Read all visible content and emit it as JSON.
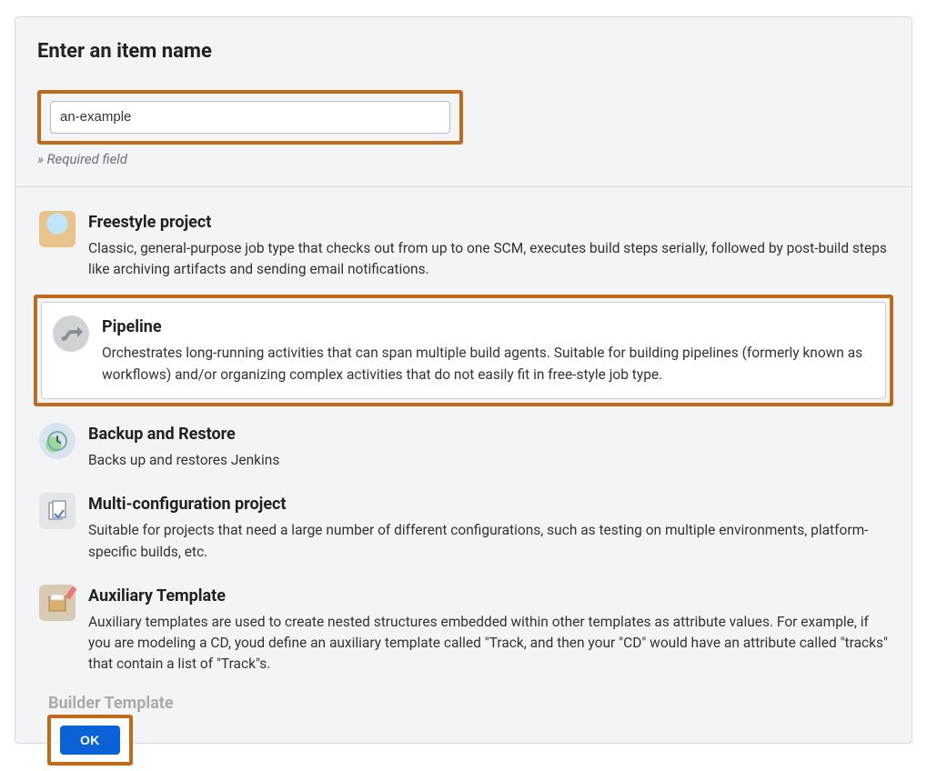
{
  "header": {
    "title": "Enter an item name",
    "input_value": "an-example",
    "input_placeholder": "",
    "required_note": "» Required field"
  },
  "types": [
    {
      "id": "freestyle",
      "title": "Freestyle project",
      "desc": "Classic, general-purpose job type that checks out from up to one SCM, executes build steps serially, followed by post-build steps like archiving artifacts and sending email notifications.",
      "selected": false,
      "highlighted": false
    },
    {
      "id": "pipeline",
      "title": "Pipeline",
      "desc": "Orchestrates long-running activities that can span multiple build agents. Suitable for building pipelines (formerly known as workflows) and/or organizing complex activities that do not easily fit in free-style job type.",
      "selected": true,
      "highlighted": true
    },
    {
      "id": "backup",
      "title": "Backup and Restore",
      "desc": "Backs up and restores Jenkins",
      "selected": false,
      "highlighted": false
    },
    {
      "id": "multi",
      "title": "Multi-configuration project",
      "desc": "Suitable for projects that need a large number of different configurations, such as testing on multiple environments, platform-specific builds, etc.",
      "selected": false,
      "highlighted": false
    },
    {
      "id": "aux",
      "title": "Auxiliary Template",
      "desc": "Auxiliary templates are used to create nested structures embedded within other templates as attribute values. For example, if you are modeling a CD, youd define an auxiliary template called \"Track, and then your \"CD\" would have an attribute called \"tracks\" that contain a list of \"Track\"s.",
      "selected": false,
      "highlighted": false
    },
    {
      "id": "builder",
      "title": "Builder Template",
      "desc": "",
      "selected": false,
      "highlighted": false
    }
  ],
  "footer": {
    "ok_label": "OK"
  },
  "colors": {
    "highlight": "#c06a1a",
    "primary_button": "#0b62d6"
  }
}
